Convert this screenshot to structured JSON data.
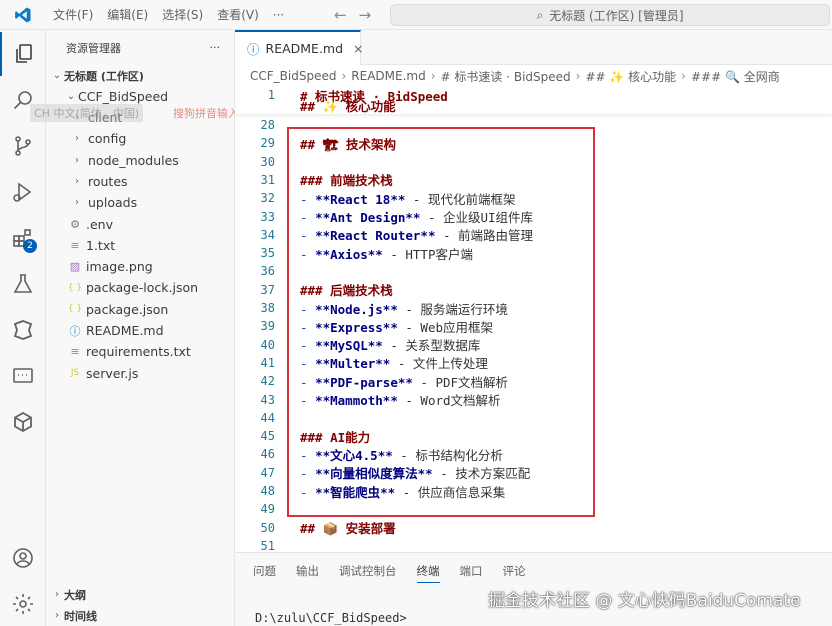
{
  "titlebar": {
    "menu": [
      "文件(F)",
      "编辑(E)",
      "选择(S)",
      "查看(V)",
      "···"
    ],
    "command_center": "无标题 (工作区) [管理员]"
  },
  "activity": {
    "badge_count": "2"
  },
  "sidebar": {
    "title": "资源管理器",
    "more": "···",
    "workspace": "无标题 (工作区)",
    "project": "CCF_BidSpeed",
    "items": [
      {
        "label": "client",
        "icon": "chevron-right-icon"
      },
      {
        "label": "config",
        "icon": "chevron-right-icon"
      },
      {
        "label": "node_modules",
        "icon": "chevron-right-icon"
      },
      {
        "label": "routes",
        "icon": "chevron-right-icon"
      },
      {
        "label": "uploads",
        "icon": "chevron-right-icon"
      },
      {
        "label": ".env",
        "icon": "gear-icon"
      },
      {
        "label": "1.txt",
        "icon": "text-file-icon"
      },
      {
        "label": "image.png",
        "icon": "image-icon"
      },
      {
        "label": "package-lock.json",
        "icon": "json-icon"
      },
      {
        "label": "package.json",
        "icon": "json-icon"
      },
      {
        "label": "README.md",
        "icon": "markdown-icon"
      },
      {
        "label": "requirements.txt",
        "icon": "text-file-icon"
      },
      {
        "label": "server.js",
        "icon": "js-icon"
      }
    ],
    "outline": "大纲",
    "timeline": "时间线",
    "ime_lang": "CH 中文(简体，中国)",
    "ime_sogou": "搜狗拼音输入法"
  },
  "editor": {
    "tab_label": "README.md",
    "breadcrumbs": [
      "CCF_BidSpeed",
      "README.md",
      "# 标书速读 · BidSpeed",
      "## ✨ 核心功能",
      "### 🔍 全网商"
    ],
    "sticky": [
      {
        "n": "1",
        "text": "# 标书速读 · BidSpeed"
      },
      {
        "n": "",
        "text": "## ✨ 核心功能"
      }
    ],
    "lines": [
      {
        "n": "28",
        "parts": []
      },
      {
        "n": "29",
        "parts": [
          {
            "c": "hdr",
            "t": "## 🏗 技术架构"
          }
        ]
      },
      {
        "n": "30",
        "parts": []
      },
      {
        "n": "31",
        "parts": [
          {
            "c": "hdr",
            "t": "### 前端技术栈"
          }
        ]
      },
      {
        "n": "32",
        "parts": [
          {
            "c": "bul",
            "t": "- "
          },
          {
            "c": "strong",
            "t": "**React 18**"
          },
          {
            "c": "plain",
            "t": " - 现代化前端框架"
          }
        ]
      },
      {
        "n": "33",
        "parts": [
          {
            "c": "bul",
            "t": "- "
          },
          {
            "c": "strong",
            "t": "**Ant Design**"
          },
          {
            "c": "plain",
            "t": " - 企业级UI组件库"
          }
        ]
      },
      {
        "n": "34",
        "parts": [
          {
            "c": "bul",
            "t": "- "
          },
          {
            "c": "strong",
            "t": "**React Router**"
          },
          {
            "c": "plain",
            "t": " - 前端路由管理"
          }
        ]
      },
      {
        "n": "35",
        "parts": [
          {
            "c": "bul",
            "t": "- "
          },
          {
            "c": "strong",
            "t": "**Axios**"
          },
          {
            "c": "plain",
            "t": " - HTTP客户端"
          }
        ]
      },
      {
        "n": "36",
        "parts": []
      },
      {
        "n": "37",
        "parts": [
          {
            "c": "hdr",
            "t": "### 后端技术栈"
          }
        ]
      },
      {
        "n": "38",
        "parts": [
          {
            "c": "bul",
            "t": "- "
          },
          {
            "c": "strong",
            "t": "**Node.js**"
          },
          {
            "c": "plain",
            "t": " - 服务端运行环境"
          }
        ]
      },
      {
        "n": "39",
        "parts": [
          {
            "c": "bul",
            "t": "- "
          },
          {
            "c": "strong",
            "t": "**Express**"
          },
          {
            "c": "plain",
            "t": " - Web应用框架"
          }
        ]
      },
      {
        "n": "40",
        "parts": [
          {
            "c": "bul",
            "t": "- "
          },
          {
            "c": "strong",
            "t": "**MySQL**"
          },
          {
            "c": "plain",
            "t": " - 关系型数据库"
          }
        ]
      },
      {
        "n": "41",
        "parts": [
          {
            "c": "bul",
            "t": "- "
          },
          {
            "c": "strong",
            "t": "**Multer**"
          },
          {
            "c": "plain",
            "t": " - 文件上传处理"
          }
        ]
      },
      {
        "n": "42",
        "parts": [
          {
            "c": "bul",
            "t": "- "
          },
          {
            "c": "strong",
            "t": "**PDF-parse**"
          },
          {
            "c": "plain",
            "t": " - PDF文档解析"
          }
        ]
      },
      {
        "n": "43",
        "parts": [
          {
            "c": "bul",
            "t": "- "
          },
          {
            "c": "strong",
            "t": "**Mammoth**"
          },
          {
            "c": "plain",
            "t": " - Word文档解析"
          }
        ]
      },
      {
        "n": "44",
        "parts": []
      },
      {
        "n": "45",
        "parts": [
          {
            "c": "hdr",
            "t": "### AI能力"
          }
        ]
      },
      {
        "n": "46",
        "parts": [
          {
            "c": "bul",
            "t": "- "
          },
          {
            "c": "strong",
            "t": "**文心4.5**"
          },
          {
            "c": "plain",
            "t": " - 标书结构化分析"
          }
        ]
      },
      {
        "n": "47",
        "parts": [
          {
            "c": "bul",
            "t": "- "
          },
          {
            "c": "strong",
            "t": "**向量相似度算法**"
          },
          {
            "c": "plain",
            "t": " - 技术方案匹配"
          }
        ]
      },
      {
        "n": "48",
        "parts": [
          {
            "c": "bul",
            "t": "- "
          },
          {
            "c": "strong",
            "t": "**智能爬虫**"
          },
          {
            "c": "plain",
            "t": " - 供应商信息采集"
          }
        ]
      },
      {
        "n": "49",
        "parts": []
      },
      {
        "n": "50",
        "parts": [
          {
            "c": "hdr",
            "t": "## 📦 安装部署"
          }
        ]
      },
      {
        "n": "51",
        "parts": []
      }
    ]
  },
  "panel": {
    "tabs": [
      "问题",
      "输出",
      "调试控制台",
      "终端",
      "端口",
      "评论"
    ],
    "active_tab": "终端",
    "terminal_prompt": "D:\\zulu\\CCF_BidSpeed>"
  },
  "watermark": "掘金技术社区 @ 文心快码BaiduComate",
  "colors": {
    "accent": "#005fb8",
    "highlight_box": "#d9303e"
  }
}
